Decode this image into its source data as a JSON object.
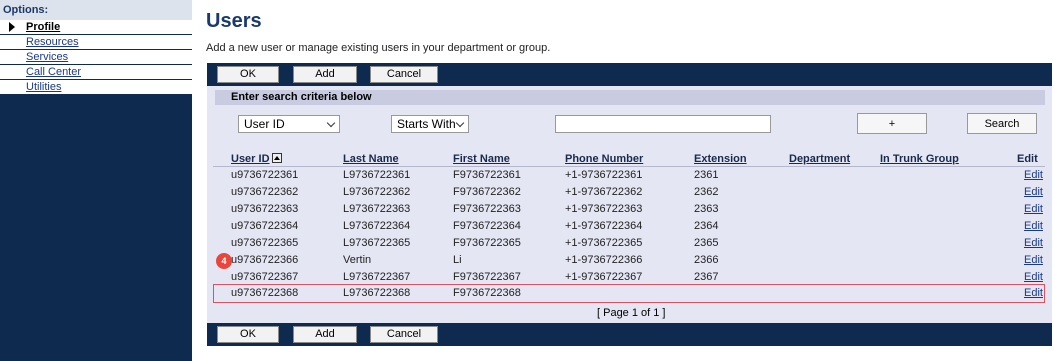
{
  "sidebar": {
    "header": "Options:",
    "items": [
      {
        "label": "Profile"
      },
      {
        "label": "Resources"
      },
      {
        "label": "Services"
      },
      {
        "label": "Call Center"
      },
      {
        "label": "Utilities"
      }
    ]
  },
  "page": {
    "title": "Users",
    "description": "Add a new user or manage existing users in your department or group."
  },
  "toolbar": {
    "ok_label": "OK",
    "add_label": "Add",
    "cancel_label": "Cancel"
  },
  "search": {
    "header": "Enter search criteria below",
    "field_value": "User ID",
    "mode_value": "Starts With",
    "text_value": "",
    "plus_label": "+",
    "search_label": "Search"
  },
  "table": {
    "headers": [
      "User ID",
      "Last Name",
      "First Name",
      "Phone Number",
      "Extension",
      "Department",
      "In Trunk Group",
      "Edit"
    ],
    "rows": [
      {
        "user_id": "u9736722361",
        "last": "L9736722361",
        "first": "F9736722361",
        "phone": "+1-9736722361",
        "ext": "2361",
        "edit": "Edit"
      },
      {
        "user_id": "u9736722362",
        "last": "L9736722362",
        "first": "F9736722362",
        "phone": "+1-9736722362",
        "ext": "2362",
        "edit": "Edit"
      },
      {
        "user_id": "u9736722363",
        "last": "L9736722363",
        "first": "F9736722363",
        "phone": "+1-9736722363",
        "ext": "2363",
        "edit": "Edit"
      },
      {
        "user_id": "u9736722364",
        "last": "L9736722364",
        "first": "F9736722364",
        "phone": "+1-9736722364",
        "ext": "2364",
        "edit": "Edit"
      },
      {
        "user_id": "u9736722365",
        "last": "L9736722365",
        "first": "F9736722365",
        "phone": "+1-9736722365",
        "ext": "2365",
        "edit": "Edit"
      },
      {
        "user_id": "u9736722366",
        "last": "Vertin",
        "first": "Li",
        "phone": "+1-9736722366",
        "ext": "2366",
        "edit": "Edit"
      },
      {
        "user_id": "u9736722367",
        "last": "L9736722367",
        "first": "F9736722367",
        "phone": "+1-9736722367",
        "ext": "2367",
        "edit": "Edit"
      },
      {
        "user_id": "u9736722368",
        "last": "L9736722368",
        "first": "F9736722368",
        "phone": "",
        "ext": "",
        "edit": "Edit"
      }
    ],
    "pagination": "[ Page 1 of 1 ]"
  },
  "annotation": {
    "marker": "4",
    "color": "#e8453c"
  },
  "colors": {
    "nav_bg": "#0e2a4f",
    "content_bg": "#e4e6f4",
    "highlight": "#e05060"
  }
}
